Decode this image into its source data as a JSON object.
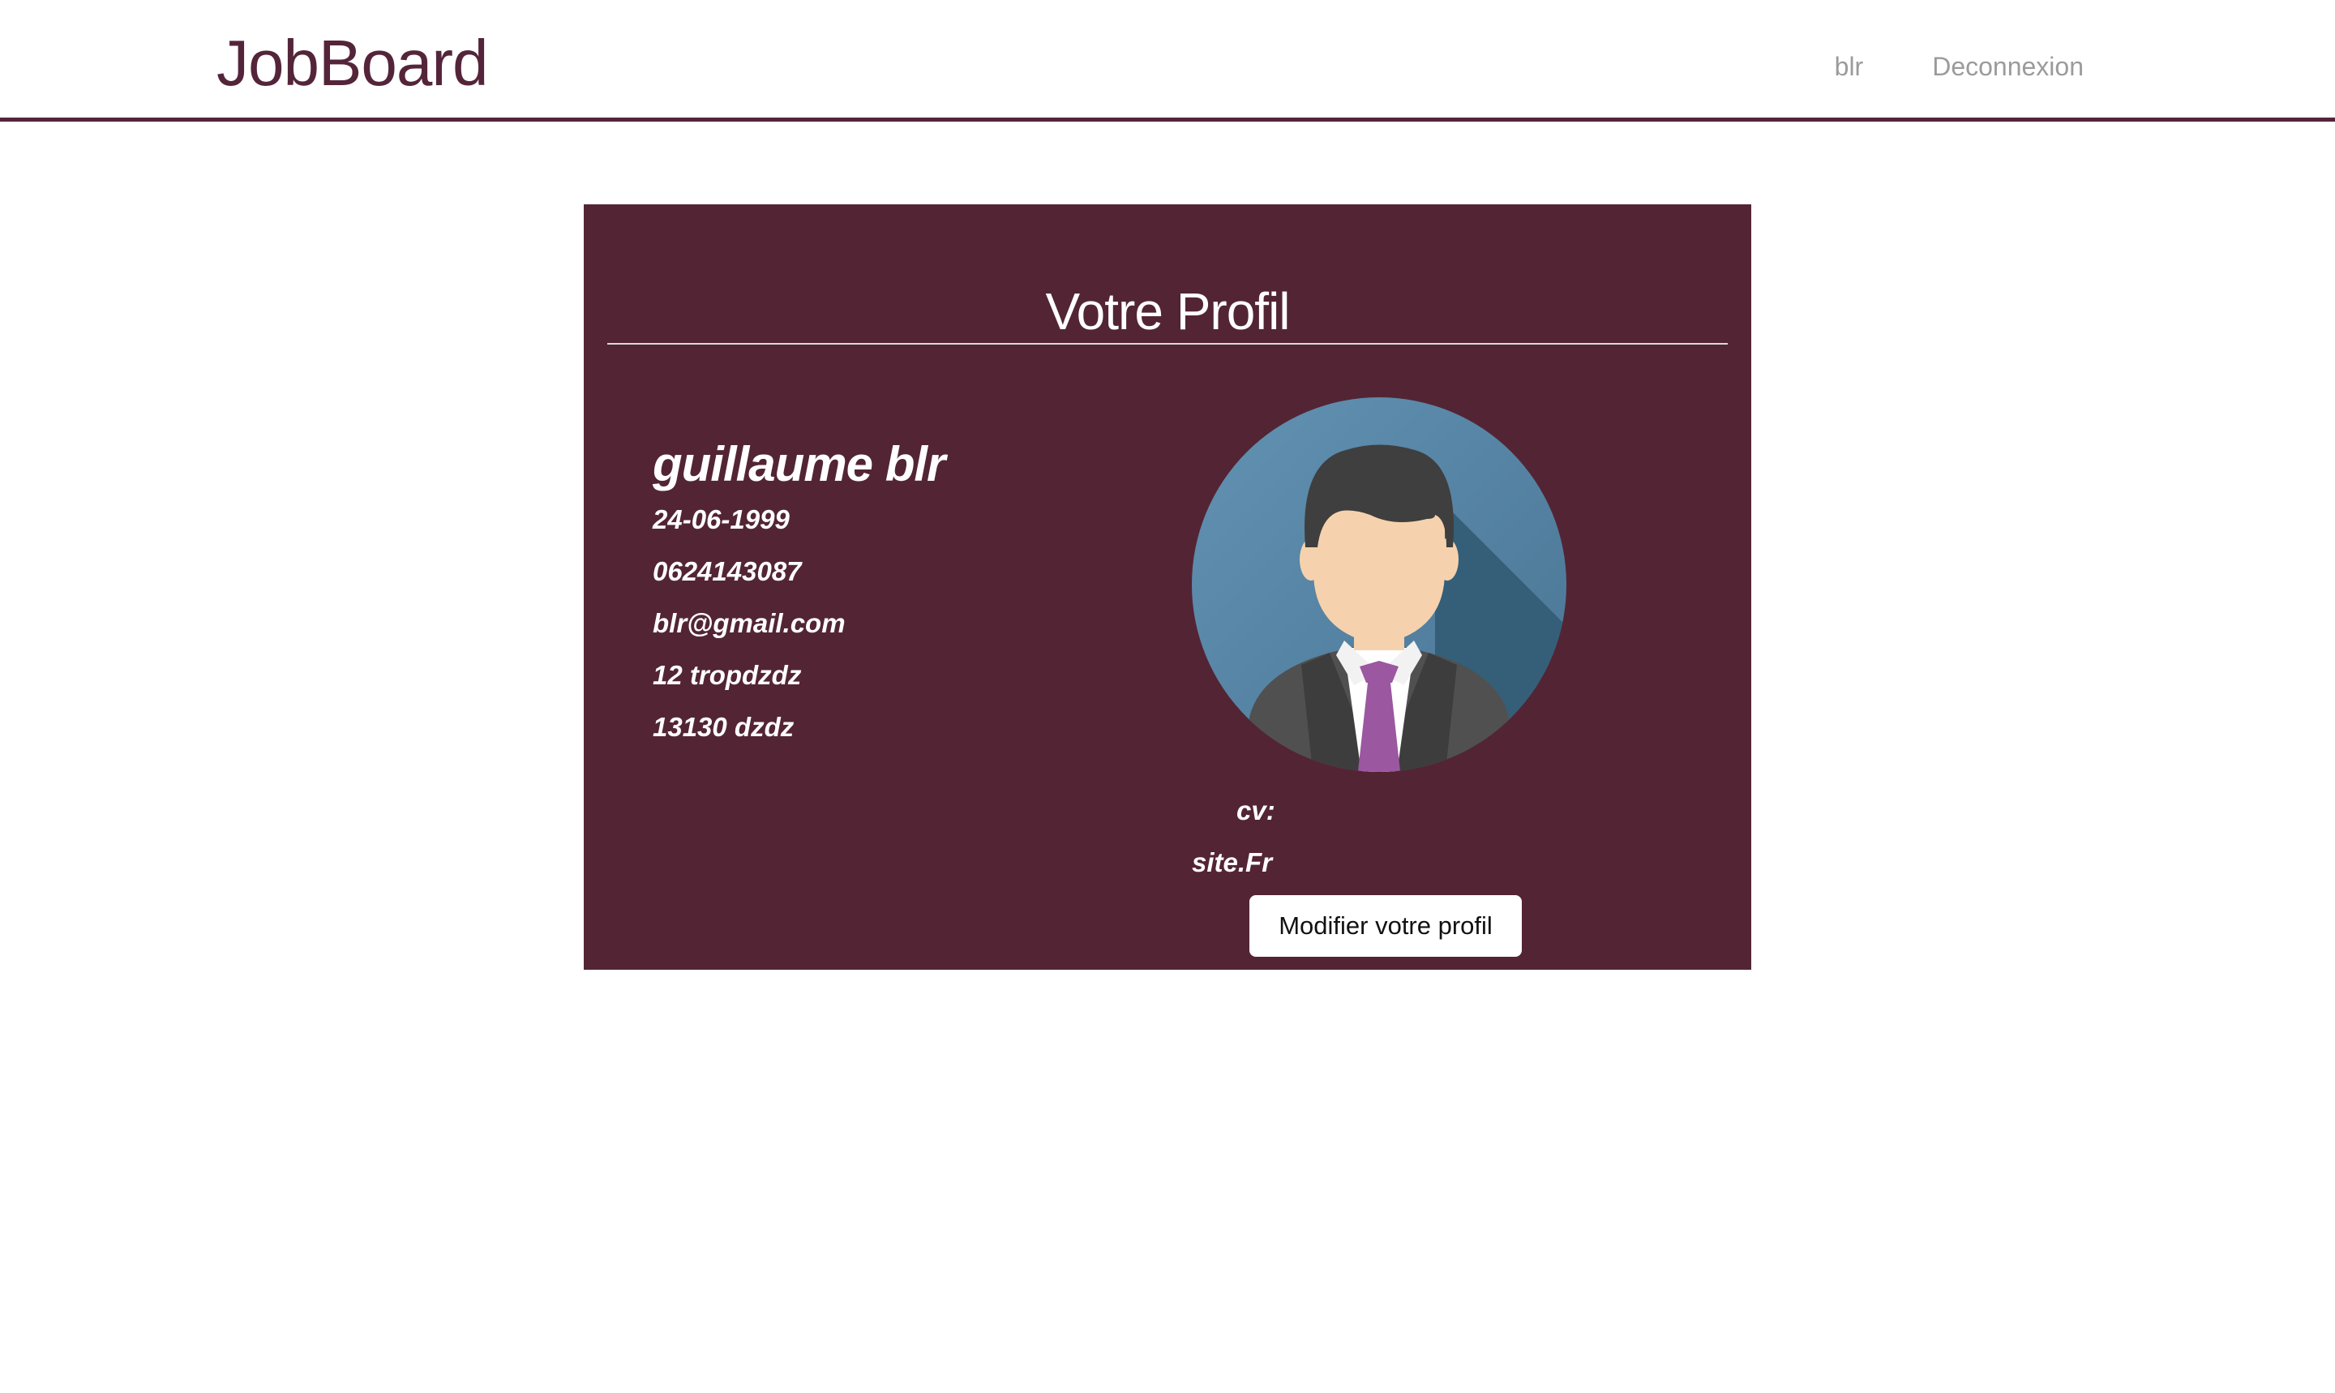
{
  "navbar": {
    "brand": "JobBoard",
    "links": [
      {
        "label": "blr"
      },
      {
        "label": "Deconnexion"
      }
    ]
  },
  "profile": {
    "title": "Votre Profil",
    "name": "guillaume blr",
    "birthdate": "24-06-1999",
    "phone": "0624143087",
    "email": "blr@gmail.com",
    "address": "12 tropdzdz",
    "city": "13130 dzdz",
    "avatar_icon": "businessman-avatar-icon",
    "cv_label": "cv:",
    "cv_value": "site.Fr",
    "edit_button": "Modifier votre profil"
  },
  "colors": {
    "brand": "#54253a",
    "card_background": "#532534",
    "nav_link": "#9b9b9b",
    "avatar_background": "#5a87a8",
    "tie": "#9b57a0"
  }
}
